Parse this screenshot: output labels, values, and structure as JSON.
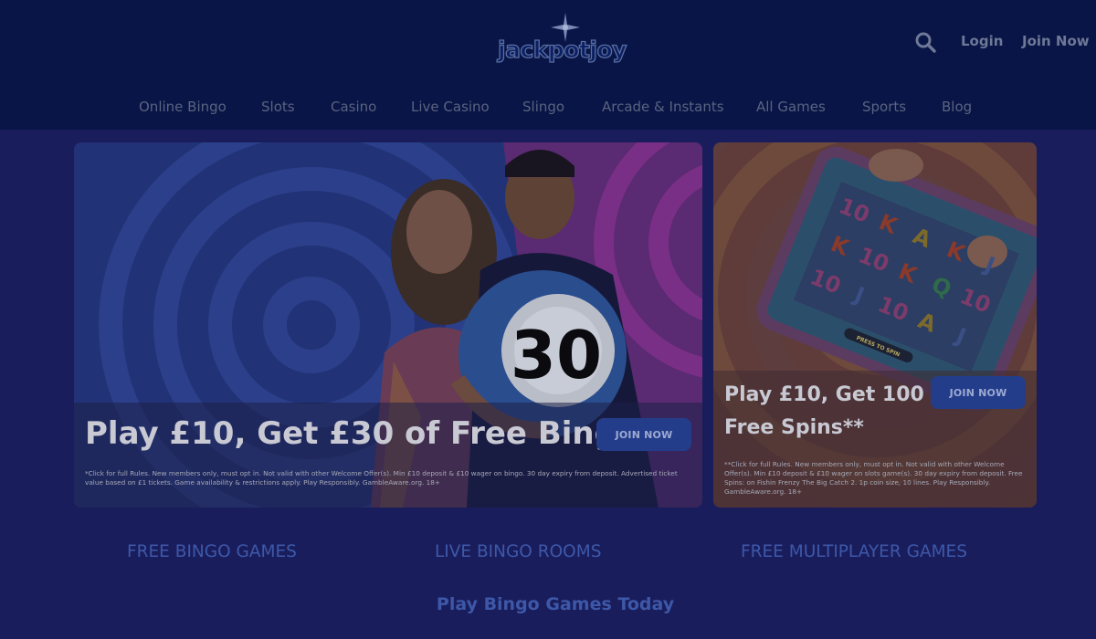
{
  "header": {
    "logo_text": "jackpotjoy",
    "search_icon": "search-icon",
    "login_label": "Login",
    "join_label": "Join Now"
  },
  "nav": {
    "items": [
      {
        "label": "Online Bingo"
      },
      {
        "label": "Slots"
      },
      {
        "label": "Casino"
      },
      {
        "label": "Live Casino"
      },
      {
        "label": "Slingo"
      },
      {
        "label": "Arcade & Instants"
      },
      {
        "label": "All Games"
      },
      {
        "label": "Sports"
      },
      {
        "label": "Blog"
      }
    ]
  },
  "promo_main": {
    "title": "Play £10, Get £30 of Free Bingo*",
    "cta": "JOIN NOW",
    "ball_number": "30",
    "terms": "*Click for full Rules. New members only, must opt in. Not valid with other Welcome Offer(s). Min £10 deposit & £10 wager on bingo. 30 day expiry from deposit. Advertised ticket value based on £1 tickets. Game availability & restrictions apply. Play Responsibly. GambleAware.org. 18+"
  },
  "promo_side": {
    "title_line1": "Play £10, Get 100",
    "title_line2": "Free Spins**",
    "cta": "JOIN NOW",
    "press_to_spin": "PRESS TO SPIN",
    "terms": "**Click for full Rules. New members only, must opt in. Not valid with other Welcome Offer(s). Min £10 deposit & £10 wager on slots game(s). 30 day expiry from deposit. Free Spins: on Fishin Frenzy The Big Catch 2. 1p coin size, 10 lines. Play Responsibly. GambleAware.org. 18+",
    "reels": [
      [
        "10",
        "K",
        "A",
        "K",
        "J"
      ],
      [
        "K",
        "10",
        "K",
        "Q",
        "10"
      ],
      [
        "10",
        "J",
        "10",
        "A",
        "J"
      ]
    ]
  },
  "categories": [
    {
      "label": "FREE BINGO GAMES"
    },
    {
      "label": "LIVE BINGO ROOMS"
    },
    {
      "label": "FREE MULTIPLAYER GAMES"
    }
  ],
  "section_heading": "Play Bingo Games Today",
  "colors": {
    "overlay_bg": "#1a1d5c",
    "header_bg": "#081546",
    "link_blue": "#3d58a8",
    "cta_bg": "#243d8b"
  }
}
